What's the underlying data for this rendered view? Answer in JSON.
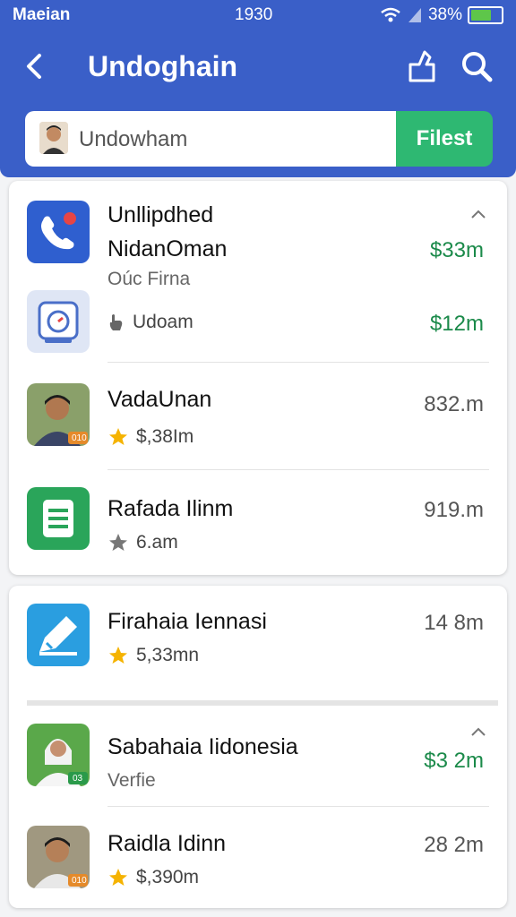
{
  "status": {
    "carrier": "Maeian",
    "time": "1930",
    "battery": "38%"
  },
  "appbar": {
    "title": "Undoghain"
  },
  "search": {
    "value": "Undowham",
    "button": "Filest"
  },
  "card1": {
    "item1": {
      "name_line1": "Unllipdhed",
      "name_line2": "NidanOman",
      "sub": "Oúc Firna",
      "price": "$33m"
    },
    "item2": {
      "sub": "Udoam",
      "price": "$12m"
    },
    "item3": {
      "name": "VadaUnan",
      "rating": "$,38Im",
      "price": "832.m",
      "badge": "010"
    },
    "item4": {
      "name": "Rafada Ilinm",
      "rating": "6.am",
      "price": "919.m"
    }
  },
  "card2": {
    "item1": {
      "name": "Firahaia Iennasi",
      "rating": "5,33mn",
      "price": "14 8m"
    },
    "item2": {
      "name": "Sabahaia Iidonesia",
      "sub": "Verfie",
      "price": "$3 2m",
      "badge": "03"
    },
    "item3": {
      "name": "Raidla Idinn",
      "rating": "$,390m",
      "price": "28 2m",
      "badge": "010"
    }
  },
  "colors": {
    "header": "#3a5fc8",
    "accent_green": "#2eb872",
    "price_green": "#1b8a4a",
    "star_gold": "#f5b301",
    "star_gray": "#777777"
  }
}
